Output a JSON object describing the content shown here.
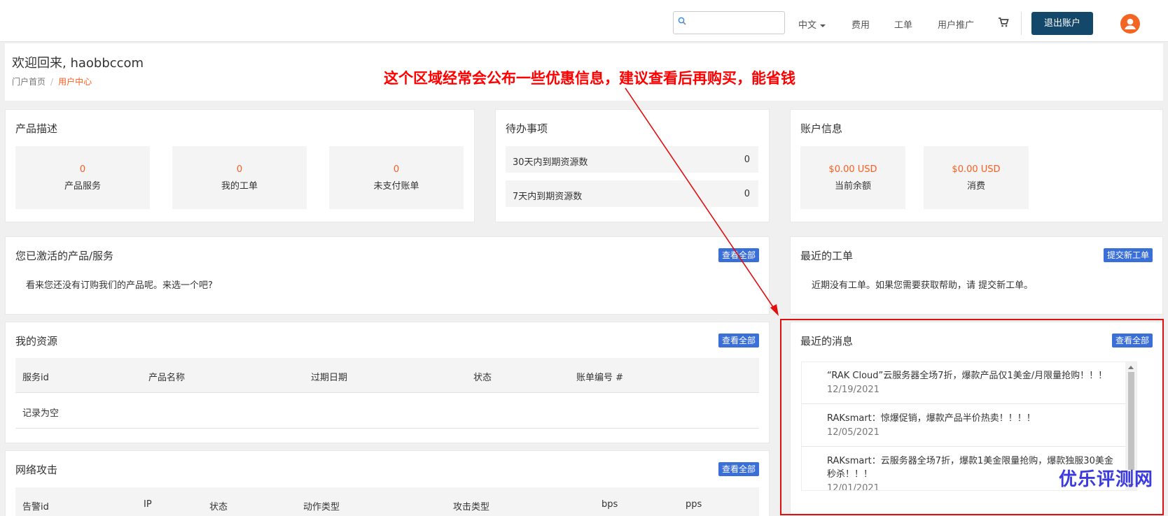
{
  "nav": {
    "search_placeholder": "",
    "language": "中文",
    "links": [
      "费用",
      "工单",
      "用户推广"
    ],
    "cart_icon": "cart-icon",
    "logout_label": "退出账户",
    "avatar_icon": "user-avatar-icon",
    "brand_color": "#14486b"
  },
  "welcome": {
    "title": "欢迎回来, haobbccom",
    "breadcrumb": [
      "门户首页",
      "用户中心"
    ]
  },
  "annotation": "这个区域经常会公布一些优惠信息，建议查看后再购买，能省钱",
  "products": {
    "title": "产品描述",
    "stats": [
      {
        "value": "0",
        "label": "产品服务"
      },
      {
        "value": "0",
        "label": "我的工单"
      },
      {
        "value": "0",
        "label": "未支付账单"
      }
    ]
  },
  "todo": {
    "title": "待办事项",
    "items": [
      {
        "label": "30天内到期资源数",
        "value": "0"
      },
      {
        "label": "7天内到期资源数",
        "value": "0"
      }
    ]
  },
  "account": {
    "title": "账户信息",
    "stats": [
      {
        "value": "$0.00 USD",
        "label": "当前余额"
      },
      {
        "value": "$0.00 USD",
        "label": "消费"
      }
    ]
  },
  "active_services": {
    "title": "您已激活的产品/服务",
    "button": "查看全部",
    "empty_text": "看来您还没有订购我们的产品呢。来选一个吧?"
  },
  "tickets": {
    "title": "最近的工单",
    "button": "提交新工单",
    "empty_text": "近期没有工单。如果您需要获取帮助，请 提交新工单。"
  },
  "resources": {
    "title": "我的资源",
    "button": "查看全部",
    "columns": [
      "服务id",
      "产品名称",
      "过期日期",
      "状态",
      "账单编号 #"
    ],
    "empty_text": "记录为空"
  },
  "attacks": {
    "title": "网络攻击",
    "button": "查看全部",
    "columns": [
      "告警id",
      "IP",
      "状态",
      "动作类型",
      "攻击类型",
      "bps",
      "pps"
    ]
  },
  "news": {
    "title": "最近的消息",
    "button": "查看全部",
    "items": [
      {
        "title": "“RAK Cloud”云服务器全场7折，爆款产品仅1美金/月限量抢购！！！",
        "date": "12/19/2021"
      },
      {
        "title": "RAKsmart：惊爆促销，爆款产品半价热卖！！！！",
        "date": "12/05/2021"
      },
      {
        "title": "RAKsmart：云服务器全场7折，爆款1美金限量抢购，爆款独服30美金秒杀！！！",
        "date": "12/01/2021"
      }
    ]
  },
  "watermark": "优乐评测网",
  "colors": {
    "accent": "#ff5d1f",
    "button": "#3a6fd8",
    "annotation": "#ff0000"
  }
}
